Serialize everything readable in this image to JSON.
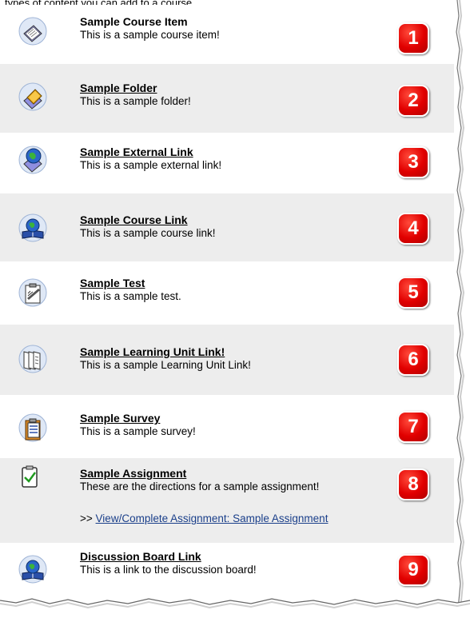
{
  "header": {
    "clipped_text": "types of content you can add to a course"
  },
  "items": [
    {
      "number": "1",
      "title": "Sample Course Item",
      "description": "This is a sample course item!",
      "icon": "course-item-icon"
    },
    {
      "number": "2",
      "title": "Sample Folder",
      "description": "This is a sample folder!",
      "icon": "folder-icon"
    },
    {
      "number": "3",
      "title": "Sample External Link",
      "description": "This is a sample external link!",
      "icon": "external-link-icon"
    },
    {
      "number": "4",
      "title": "Sample Course Link",
      "description": "This is a sample course link!",
      "icon": "course-link-icon"
    },
    {
      "number": "5",
      "title": "Sample Test",
      "description": "This is a sample test.",
      "icon": "test-icon"
    },
    {
      "number": "6",
      "title": "Sample Learning Unit Link!",
      "description": "This is a sample Learning Unit Link!",
      "icon": "learning-unit-icon"
    },
    {
      "number": "7",
      "title": "Sample Survey",
      "description": "This is a sample survey!",
      "icon": "survey-icon"
    },
    {
      "number": "8",
      "title": "Sample Assignment",
      "description": "These are the directions for a sample assignment!",
      "icon": "assignment-icon",
      "sublink_prefix": ">>",
      "sublink_label": "View/Complete Assignment: Sample Assignment"
    },
    {
      "number": "9",
      "title": "Discussion Board Link",
      "description": "This is a link to the discussion board!",
      "icon": "discussion-board-icon"
    }
  ],
  "colors": {
    "badge": "#e10000",
    "row_alt": "#ededed",
    "link": "#1a3f8a"
  }
}
